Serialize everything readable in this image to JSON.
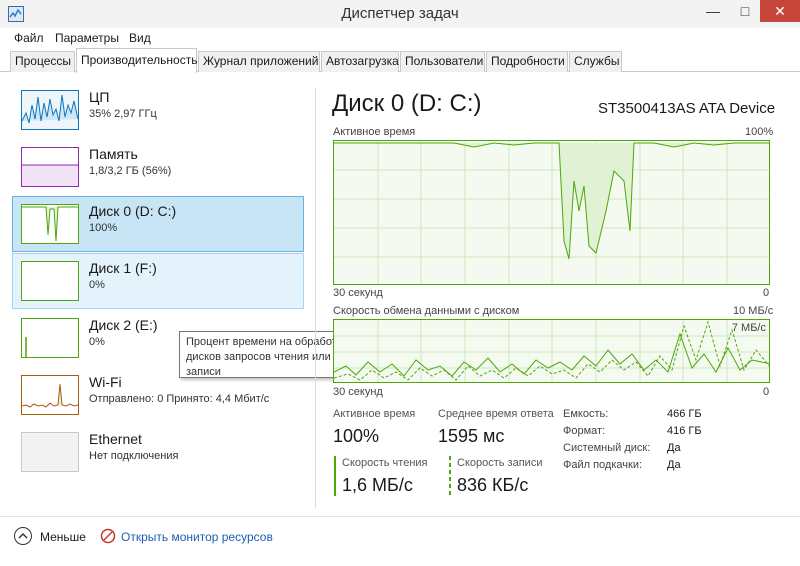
{
  "window": {
    "title": "Диспетчер задач",
    "minimize": "—",
    "maximize": "□",
    "close": "✕",
    "app_icon": "task-manager-icon"
  },
  "menu": [
    "Файл",
    "Параметры",
    "Вид"
  ],
  "tabs": [
    "Процессы",
    "Производительность",
    "Журнал приложений",
    "Автозагрузка",
    "Пользователи",
    "Подробности",
    "Службы"
  ],
  "active_tab": "Производительность",
  "devices": [
    {
      "name": "ЦП",
      "sub": "35% 2,97 ГГц",
      "color": "#1175ba"
    },
    {
      "name": "Память",
      "sub": "1,8/3,2 ГБ (56%)",
      "color": "#8b2fa8"
    },
    {
      "name": "Диск 0 (D: C:)",
      "sub": "100%",
      "color": "#4da60c"
    },
    {
      "name": "Диск 1 (F:)",
      "sub": "0%",
      "color": "#4da60c"
    },
    {
      "name": "Диск 2 (E:)",
      "sub": "0%",
      "color": "#4da60c"
    },
    {
      "name": "Wi-Fi",
      "sub": "Отправлено: 0 Принято: 4,4 Мбит/с",
      "color": "#a65d10"
    },
    {
      "name": "Ethernet",
      "sub": "Нет подключения",
      "color": "#a0a0a0"
    }
  ],
  "tooltip": "Процент времени на обработку дисков запросов чтения или записи",
  "detail": {
    "title": "Диск 0 (D: C:)",
    "model": "ST3500413AS ATA Device",
    "graph1": {
      "label": "Активное время",
      "max": "100%",
      "time": "30 секунд",
      "min": "0"
    },
    "graph2": {
      "label": "Скорость обмена данными с диском",
      "max": "10 МБ/с",
      "sub_max": "7 МБ/с",
      "time": "30 секунд",
      "min": "0"
    },
    "stats": {
      "active_label": "Активное время",
      "active_value": "100%",
      "response_label": "Среднее время ответа",
      "response_value": "1595 мс",
      "read_label": "Скорость чтения",
      "read_value": "1,6 МБ/с",
      "write_label": "Скорость записи",
      "write_value": "836 КБ/с"
    },
    "props": [
      {
        "label": "Емкость:",
        "value": "466 ГБ"
      },
      {
        "label": "Формат:",
        "value": "416 ГБ"
      },
      {
        "label": "Системный диск:",
        "value": "Да"
      },
      {
        "label": "Файл подкачки:",
        "value": "Да"
      }
    ]
  },
  "footer": {
    "less": "Меньше",
    "resmon": "Открыть монитор ресурсов"
  }
}
